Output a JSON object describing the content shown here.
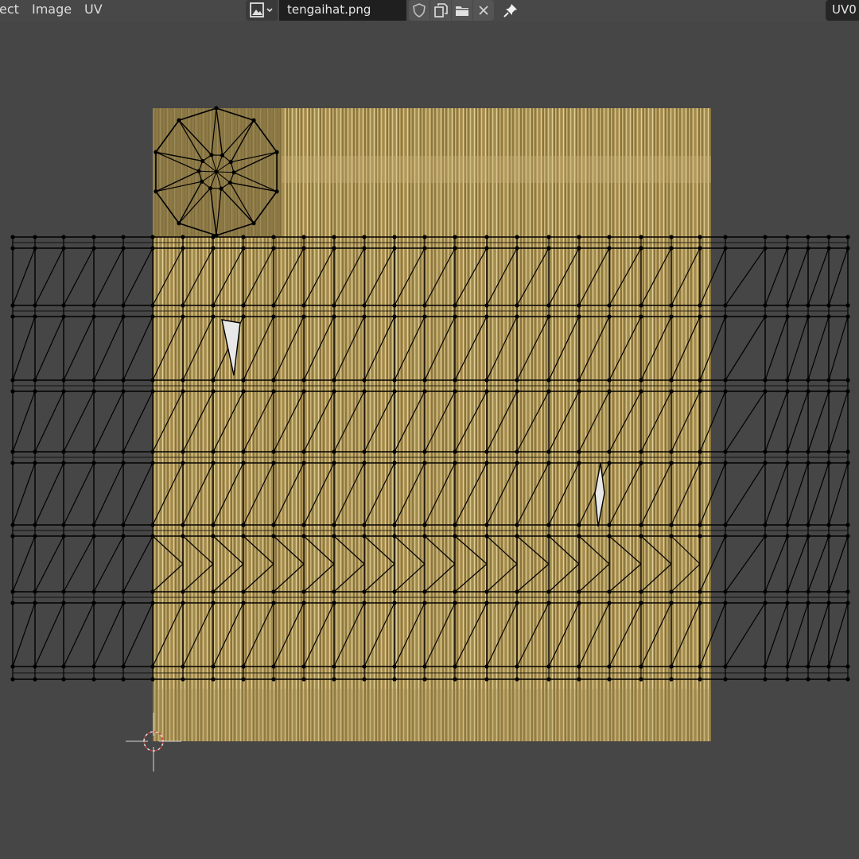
{
  "header": {
    "menus": {
      "view": "ect",
      "image": "Image",
      "uv": "UV"
    },
    "image_name": "tengaihat.png",
    "uv_map": "UV0"
  },
  "icons": {
    "image_browse": "image-icon",
    "fake_user": "shield-icon",
    "new_image": "duplicate-icon",
    "open_image": "folder-icon",
    "unlink": "close-icon",
    "pin": "pin-icon",
    "cursor": "2d-cursor-icon"
  },
  "colors": {
    "editor_bg": "#464646",
    "header_bg": "#484848",
    "texture_base": "#b39a5c",
    "uv_edge": "#000000",
    "uv_vertex": "#000000",
    "selected_face": "#e8e8e8",
    "cursor": "#d04040"
  }
}
